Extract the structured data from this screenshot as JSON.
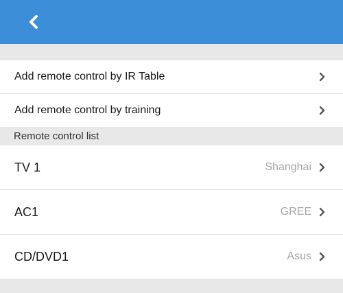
{
  "header": {
    "back_icon": "chevron-left-icon",
    "bg_color": "#3d8ed8"
  },
  "menu": {
    "items": [
      {
        "label": "Add remote control by IR Table",
        "icon": "chevron-right-icon"
      },
      {
        "label": "Add remote control by training",
        "icon": "chevron-right-icon"
      }
    ]
  },
  "remote_list": {
    "section_title": "Remote control list",
    "devices": [
      {
        "name": "TV 1",
        "brand": "Shanghai",
        "icon": "chevron-right-icon"
      },
      {
        "name": "AC1",
        "brand": "GREE",
        "icon": "chevron-right-icon"
      },
      {
        "name": "CD/DVD1",
        "brand": "Asus",
        "icon": "chevron-right-icon"
      }
    ]
  }
}
